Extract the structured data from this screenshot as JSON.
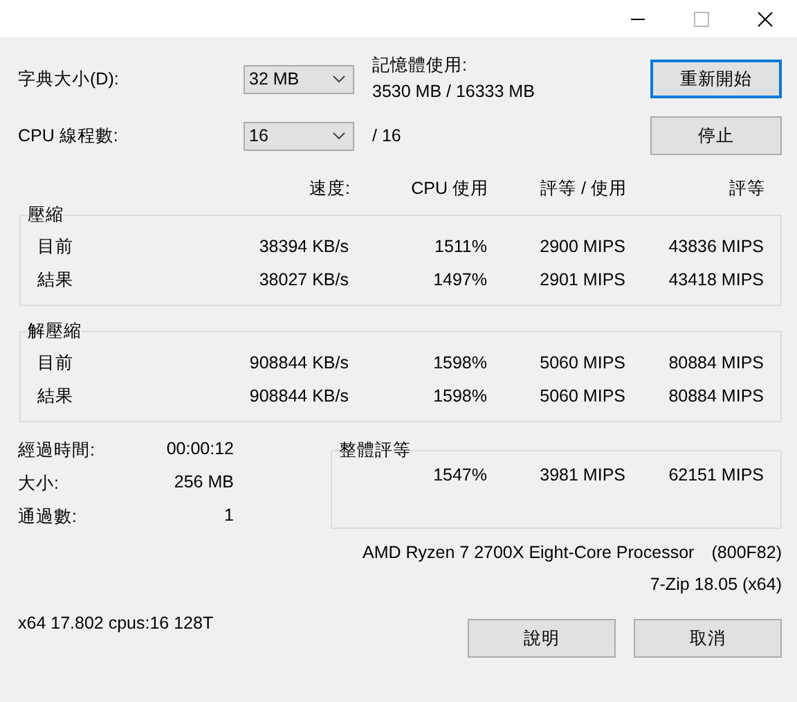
{
  "settings": [
    {
      "label": "字典大小(D):",
      "value": "32 MB"
    },
    {
      "label": "CPU 線程數:",
      "value": "16"
    }
  ],
  "memory": {
    "label": "記憶體使用:",
    "value": "3530 MB / 16333 MB"
  },
  "threads_total": "/ 16",
  "buttons_top": [
    {
      "label": "重新開始",
      "default": true
    },
    {
      "label": "停止",
      "default": false
    }
  ],
  "columns": [
    "速度:",
    "CPU 使用",
    "評等 / 使用",
    "評等"
  ],
  "groups": [
    {
      "title": "壓縮",
      "rows": [
        [
          "目前",
          "38394 KB/s",
          "1511%",
          "2900 MIPS",
          "43836 MIPS"
        ],
        [
          "結果",
          "38027 KB/s",
          "1497%",
          "2901 MIPS",
          "43418 MIPS"
        ]
      ]
    },
    {
      "title": "解壓縮",
      "rows": [
        [
          "目前",
          "908844 KB/s",
          "1598%",
          "5060 MIPS",
          "80884 MIPS"
        ],
        [
          "結果",
          "908844 KB/s",
          "1598%",
          "5060 MIPS",
          "80884 MIPS"
        ]
      ]
    }
  ],
  "stats": [
    {
      "label": "經過時間:",
      "value": "00:00:12"
    },
    {
      "label": "大小:",
      "value": "256 MB"
    },
    {
      "label": "通過數:",
      "value": "1"
    }
  ],
  "total": {
    "title": "整體評等",
    "values": [
      "1547%",
      "3981 MIPS",
      "62151 MIPS"
    ]
  },
  "cpu": {
    "name": "AMD Ryzen 7 2700X Eight-Core Processor",
    "id": "(800F82)"
  },
  "version": "7-Zip 18.05 (x64)",
  "build_info": "x64 17.802 cpus:16 128T",
  "buttons_bottom": [
    {
      "label": "說明"
    },
    {
      "label": "取消"
    }
  ]
}
